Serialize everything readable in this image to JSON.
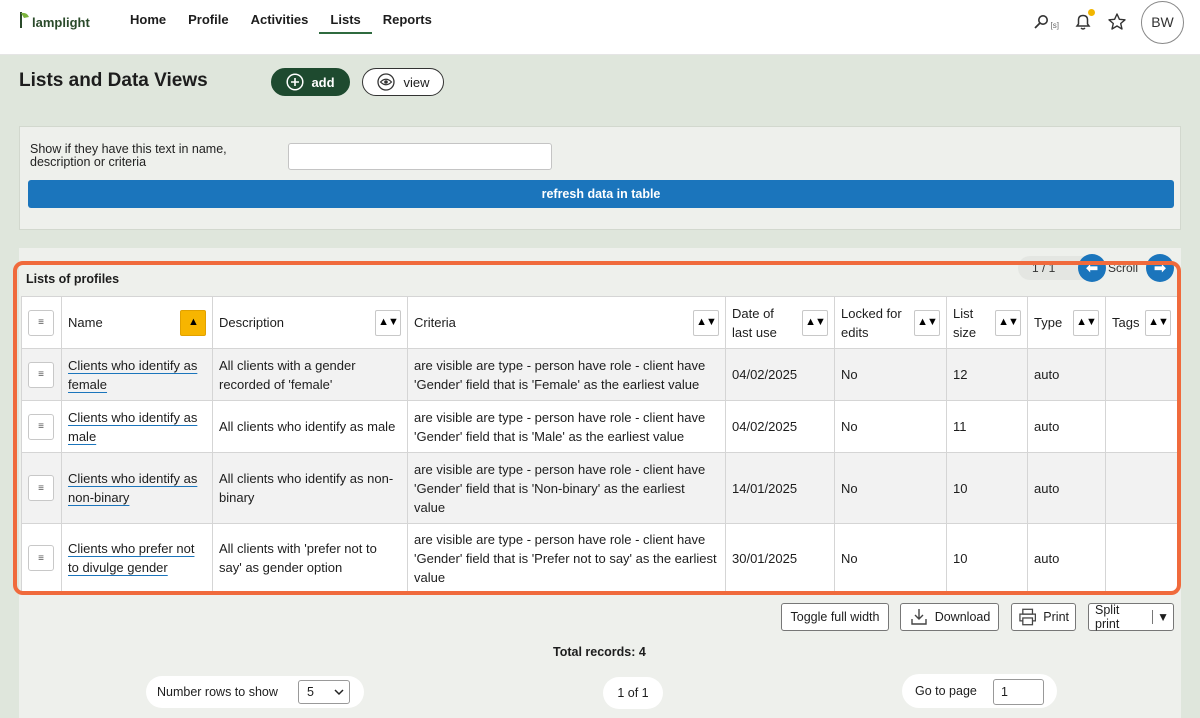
{
  "app": {
    "name": "lamplight"
  },
  "nav": {
    "items": [
      {
        "label": "Home"
      },
      {
        "label": "Profile"
      },
      {
        "label": "Activities"
      },
      {
        "label": "Lists"
      },
      {
        "label": "Reports"
      }
    ],
    "active": "Lists"
  },
  "top_icons": {
    "search_shortcut": "[s]",
    "avatar_initials": "BW",
    "search_icon": "magnifier-icon",
    "bell_icon": "bell-icon",
    "star_icon": "star-icon"
  },
  "header": {
    "title": "Lists and Data Views",
    "add_label": "add",
    "view_label": "view"
  },
  "filter": {
    "label": "Show if they have this text in name, description or criteria",
    "input_value": "",
    "refresh_label": "refresh data in table"
  },
  "table": {
    "title": "Lists of profiles",
    "page_indicator": "1 / 1",
    "scroll_label": "Scroll",
    "sort_glyph": "▲▼",
    "active_sort_glyph": "▲",
    "handle_glyph": "≡",
    "columns": [
      {
        "label": "Name"
      },
      {
        "label": "Description"
      },
      {
        "label": "Criteria"
      },
      {
        "label": "Date of last use"
      },
      {
        "label": "Locked for edits"
      },
      {
        "label": "List size"
      },
      {
        "label": "Type"
      },
      {
        "label": "Tags"
      }
    ],
    "rows": [
      {
        "name": "Clients who identify as female",
        "description": "All clients with a gender recorded of 'female'",
        "criteria": "are visible are type - person have role - client have 'Gender' field that is 'Female' as the earliest value",
        "date": "04/02/2025",
        "locked": "No",
        "size": "12",
        "type": "auto",
        "tags": ""
      },
      {
        "name": "Clients who identify as male",
        "description": "All clients who identify as male",
        "criteria": "are visible are type - person have role - client have 'Gender' field that is 'Male' as the earliest value",
        "date": "04/02/2025",
        "locked": "No",
        "size": "11",
        "type": "auto",
        "tags": ""
      },
      {
        "name": "Clients who identify as non-binary",
        "description": "All clients who identify as non-binary",
        "criteria": "are visible are type - person have role - client have 'Gender' field that is 'Non-binary' as the earliest value",
        "date": "14/01/2025",
        "locked": "No",
        "size": "10",
        "type": "auto",
        "tags": ""
      },
      {
        "name": "Clients who prefer not to divulge gender",
        "description": "All clients with 'prefer not to say' as gender option",
        "criteria": "are visible are type - person have role - client have 'Gender' field that is 'Prefer not to say' as the earliest value",
        "date": "30/01/2025",
        "locked": "No",
        "size": "10",
        "type": "auto",
        "tags": ""
      }
    ]
  },
  "tools": {
    "toggle_width": "Toggle full width",
    "download": "Download",
    "print": "Print",
    "split_print": "Split print"
  },
  "footer": {
    "total": "Total records: 4",
    "rows_label": "Number rows to show",
    "rows_value": "5",
    "page_indicator": "1 of 1",
    "goto_label": "Go to page",
    "goto_value": "1"
  },
  "colors": {
    "brand_green": "#1e4a2f",
    "primary_blue": "#1b75bc",
    "highlight": "#f06a3c",
    "sort_active": "#f7b500"
  }
}
